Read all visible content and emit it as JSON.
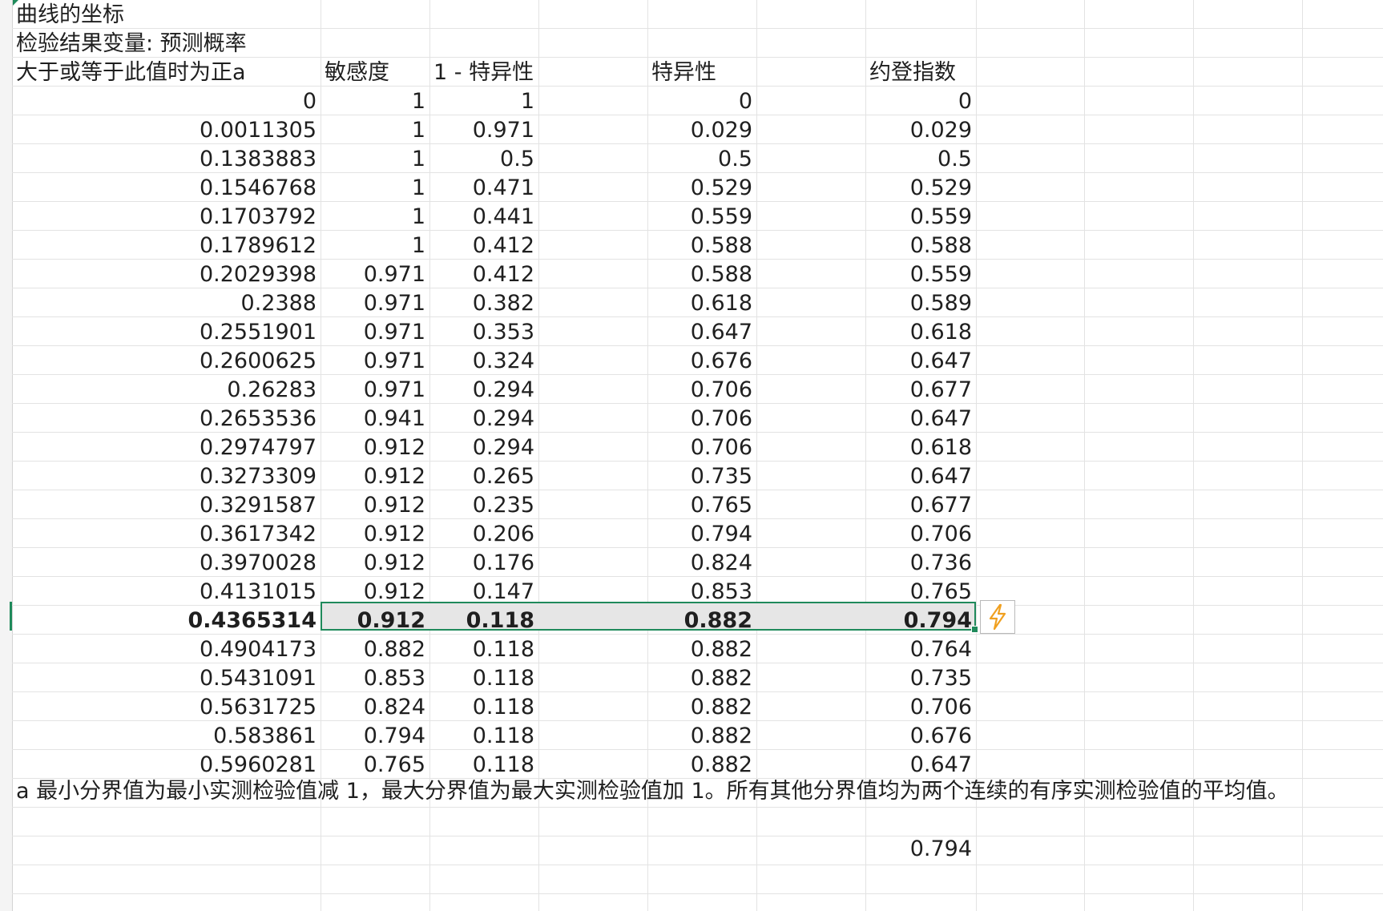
{
  "title_lines": {
    "line1": "曲线的坐标",
    "line2": "检验结果变量:  预测概率"
  },
  "headers": [
    "大于或等于此值时为正a",
    "敏感度",
    "1 - 特异性",
    "特异性",
    "约登指数"
  ],
  "rows": [
    [
      "0",
      "1",
      "1",
      "0",
      "0"
    ],
    [
      "0.0011305",
      "1",
      "0.971",
      "0.029",
      "0.029"
    ],
    [
      "0.1383883",
      "1",
      "0.5",
      "0.5",
      "0.5"
    ],
    [
      "0.1546768",
      "1",
      "0.471",
      "0.529",
      "0.529"
    ],
    [
      "0.1703792",
      "1",
      "0.441",
      "0.559",
      "0.559"
    ],
    [
      "0.1789612",
      "1",
      "0.412",
      "0.588",
      "0.588"
    ],
    [
      "0.2029398",
      "0.971",
      "0.412",
      "0.588",
      "0.559"
    ],
    [
      "0.2388",
      "0.971",
      "0.382",
      "0.618",
      "0.589"
    ],
    [
      "0.2551901",
      "0.971",
      "0.353",
      "0.647",
      "0.618"
    ],
    [
      "0.2600625",
      "0.971",
      "0.324",
      "0.676",
      "0.647"
    ],
    [
      "0.26283",
      "0.971",
      "0.294",
      "0.706",
      "0.677"
    ],
    [
      "0.2653536",
      "0.941",
      "0.294",
      "0.706",
      "0.647"
    ],
    [
      "0.2974797",
      "0.912",
      "0.294",
      "0.706",
      "0.618"
    ],
    [
      "0.3273309",
      "0.912",
      "0.265",
      "0.735",
      "0.647"
    ],
    [
      "0.3291587",
      "0.912",
      "0.235",
      "0.765",
      "0.677"
    ],
    [
      "0.3617342",
      "0.912",
      "0.206",
      "0.794",
      "0.706"
    ],
    [
      "0.3970028",
      "0.912",
      "0.176",
      "0.824",
      "0.736"
    ],
    [
      "0.4131015",
      "0.912",
      "0.147",
      "0.853",
      "0.765"
    ],
    [
      "0.4365314",
      "0.912",
      "0.118",
      "0.882",
      "0.794"
    ],
    [
      "0.4904173",
      "0.882",
      "0.118",
      "0.882",
      "0.764"
    ],
    [
      "0.5431091",
      "0.853",
      "0.118",
      "0.882",
      "0.735"
    ],
    [
      "0.5631725",
      "0.824",
      "0.118",
      "0.882",
      "0.706"
    ],
    [
      "0.583861",
      "0.794",
      "0.118",
      "0.882",
      "0.676"
    ],
    [
      "0.5960281",
      "0.765",
      "0.118",
      "0.882",
      "0.647"
    ]
  ],
  "selected_row_index": 18,
  "footnote": "a 最小分界值为最小实测检验值减 1，最大分界值为最大实测检验值加 1。所有其他分界值均为两个连续的有序实测检验值的平均值。",
  "extra_value": "0.794",
  "icons": {
    "flash_fill": "lightning-icon"
  },
  "colors": {
    "selection_border": "#1f8a5b",
    "selection_fill": "#e6e6e6",
    "lightning": "#f0a020"
  }
}
